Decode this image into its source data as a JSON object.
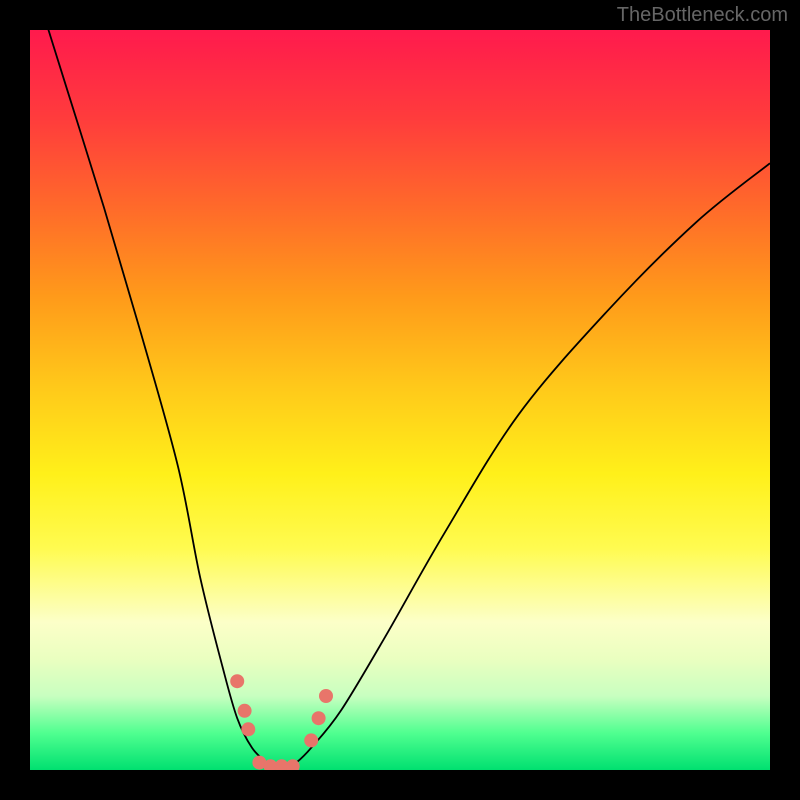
{
  "watermark": "TheBottleneck.com",
  "chart_data": {
    "type": "line",
    "title": "",
    "xlabel": "",
    "ylabel": "",
    "xlim": [
      0,
      100
    ],
    "ylim": [
      0,
      100
    ],
    "background_gradient": {
      "direction": "top-to-bottom",
      "stops": [
        {
          "pos": 0.0,
          "color": "#ff1a4d"
        },
        {
          "pos": 0.5,
          "color": "#ffe01a"
        },
        {
          "pos": 0.82,
          "color": "#fcffc8"
        },
        {
          "pos": 1.0,
          "color": "#00e070"
        }
      ]
    },
    "curve": {
      "description": "V-shaped bottleneck curve; x is component ratio, y is bottleneck severity (top=high, bottom=low)",
      "x": [
        0,
        5,
        10,
        15,
        20,
        23,
        26,
        28,
        30,
        32,
        33,
        34,
        35,
        36,
        38,
        42,
        48,
        56,
        66,
        78,
        90,
        100
      ],
      "y": [
        108,
        92,
        76,
        59,
        41,
        26,
        14,
        7,
        3,
        1,
        0.5,
        0.5,
        0.5,
        1,
        3,
        8,
        18,
        32,
        48,
        62,
        74,
        82
      ]
    },
    "markers": {
      "color": "#e8756a",
      "radius": 7,
      "points": [
        {
          "x": 28.0,
          "y": 12
        },
        {
          "x": 29.0,
          "y": 8
        },
        {
          "x": 29.5,
          "y": 5.5
        },
        {
          "x": 31.0,
          "y": 1.0
        },
        {
          "x": 32.5,
          "y": 0.5
        },
        {
          "x": 34.0,
          "y": 0.5
        },
        {
          "x": 35.5,
          "y": 0.5
        },
        {
          "x": 38.0,
          "y": 4.0
        },
        {
          "x": 39.0,
          "y": 7.0
        },
        {
          "x": 40.0,
          "y": 10.0
        }
      ]
    }
  }
}
